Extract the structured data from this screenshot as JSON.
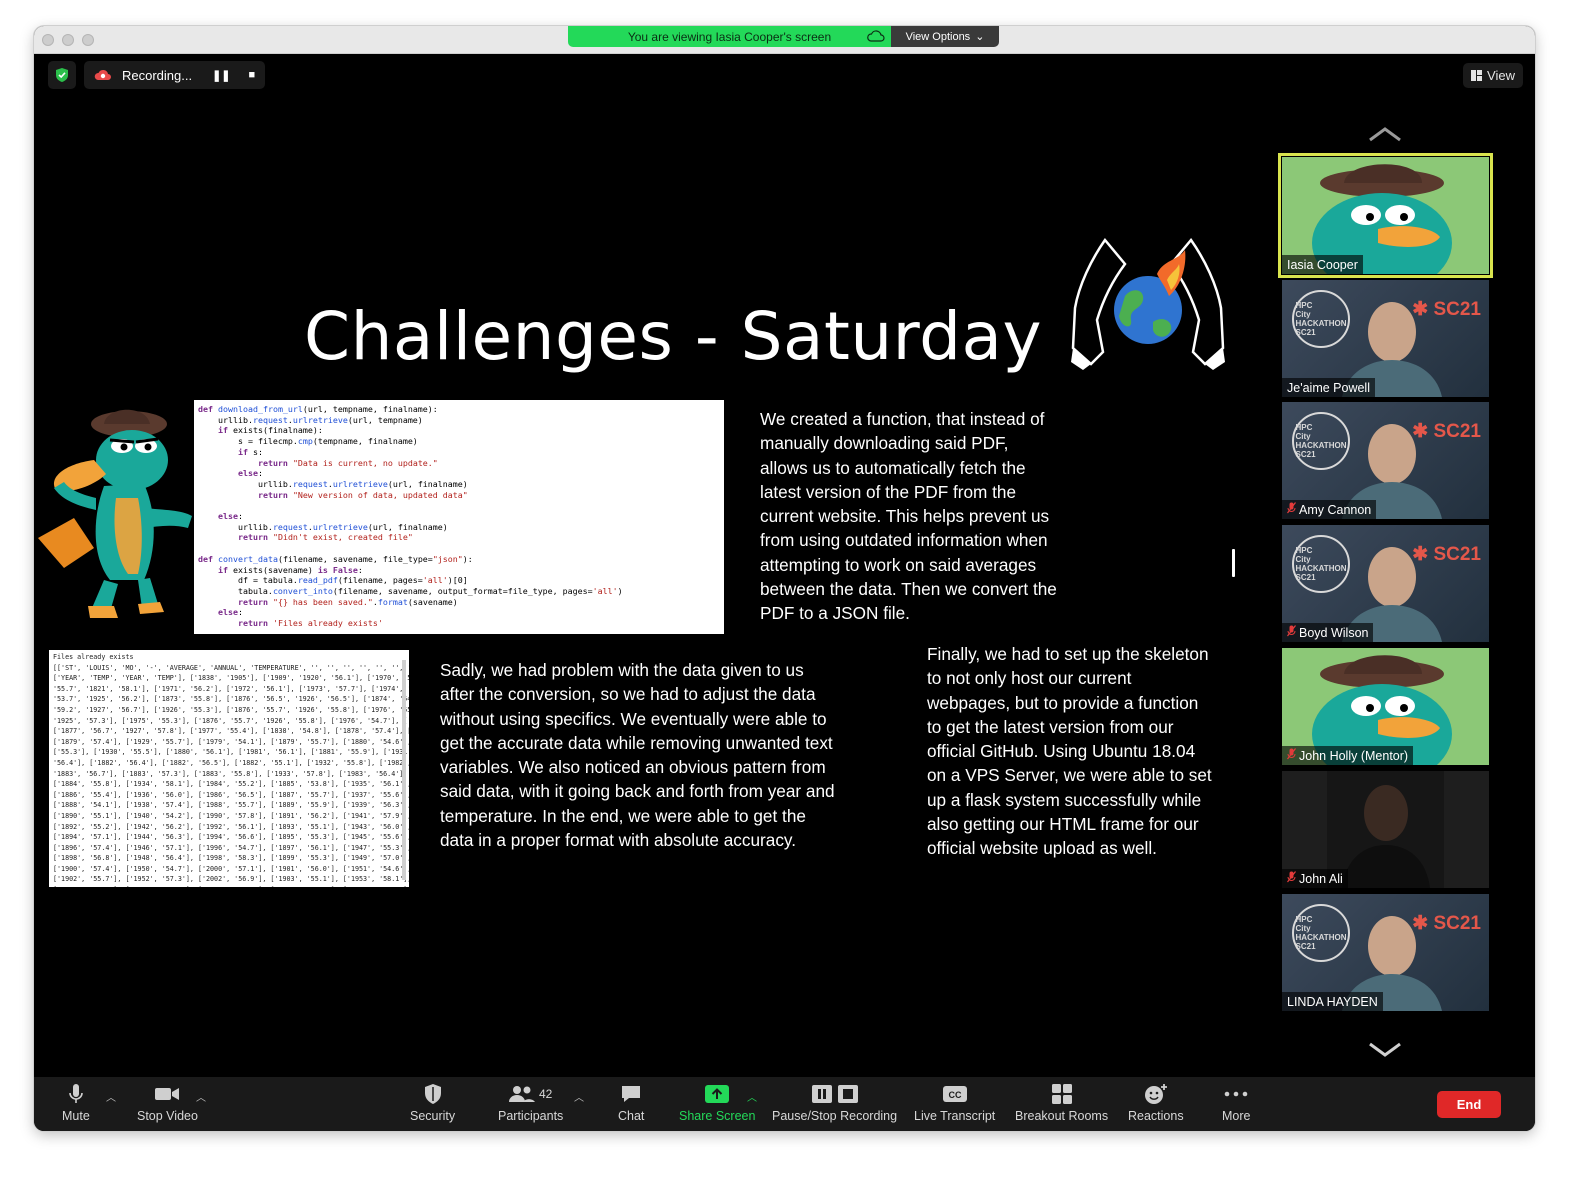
{
  "share_banner": {
    "text": "You are viewing Iasia Cooper's screen",
    "view_options": "View Options"
  },
  "recording": {
    "label": "Recording..."
  },
  "view_button": {
    "label": "View"
  },
  "slide": {
    "title": "Challenges - Saturday",
    "paragraph1": "We created a function, that instead of manually downloading said PDF, allows us to automatically fetch the latest version of the PDF from the current website. This helps prevent us from using outdated information when attempting to work on said averages between the data. Then we convert the PDF to a JSON file.",
    "paragraph2": "Sadly, we had problem with the data given to us after the conversion, so we had to adjust the data without using specifics. We eventually were able to get the accurate data while removing unwanted text variables. We also noticed an obvious pattern from said data, with it going back and forth from year and temperature. In the end, we were able to get the data in a proper format with absolute accuracy.",
    "paragraph3": "Finally, we had to set up the skeleton to not only host our current webpages, but to provide a function to get the latest  version from our official GitHub. Using Ubuntu 18.04 on a VPS Server, we were able to set up a flask system successfully while also getting our HTML frame for our official website upload as well."
  },
  "participants_gallery": [
    {
      "name": "Iasia Cooper",
      "muted": false,
      "active": true,
      "video": "cartoon"
    },
    {
      "name": "Je'aime Powell",
      "muted": false,
      "active": false,
      "video": "hpc"
    },
    {
      "name": "Amy Cannon",
      "muted": true,
      "active": false,
      "video": "hpc"
    },
    {
      "name": "Boyd Wilson",
      "muted": true,
      "active": false,
      "video": "hpc"
    },
    {
      "name": "John Holly (Mentor)",
      "muted": true,
      "active": false,
      "video": "cartoon"
    },
    {
      "name": "John Ali",
      "muted": true,
      "active": false,
      "video": "person"
    },
    {
      "name": "LINDA HAYDEN",
      "muted": false,
      "active": false,
      "video": "hpc"
    }
  ],
  "toolbar": {
    "mute": "Mute",
    "stop_video": "Stop Video",
    "security": "Security",
    "participants": "Participants",
    "participants_count": "42",
    "chat": "Chat",
    "share_screen": "Share Screen",
    "pause_stop_recording": "Pause/Stop Recording",
    "live_transcript": "Live Transcript",
    "breakout_rooms": "Breakout Rooms",
    "reactions": "Reactions",
    "more": "More",
    "end": "End"
  },
  "colors": {
    "share_green": "#23d959",
    "active_tile": "#d9e44e",
    "end_red": "#e02828",
    "muted_red": "#e23b3b"
  }
}
